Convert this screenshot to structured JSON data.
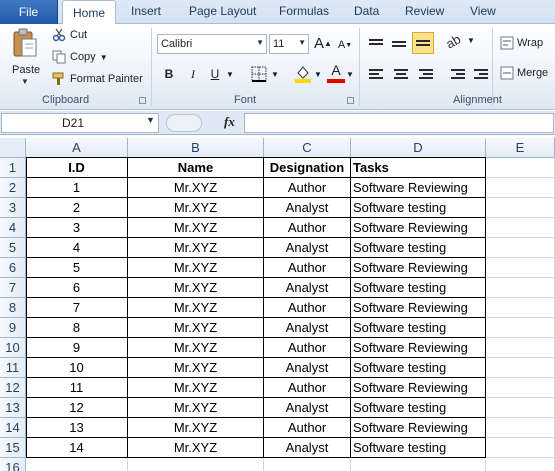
{
  "ribbon": {
    "tabs": [
      {
        "label": "File"
      },
      {
        "label": "Home"
      },
      {
        "label": "Insert"
      },
      {
        "label": "Page Layout"
      },
      {
        "label": "Formulas"
      },
      {
        "label": "Data"
      },
      {
        "label": "Review"
      },
      {
        "label": "View"
      }
    ],
    "clipboard": {
      "paste_label": "Paste",
      "cut_label": "Cut",
      "copy_label": "Copy",
      "format_painter_label": "Format Painter",
      "group_label": "Clipboard"
    },
    "font": {
      "font_name": "Calibri",
      "font_size": "11",
      "bold_label": "B",
      "italic_label": "I",
      "underline_label": "U",
      "grow_label": "A",
      "shrink_label": "A",
      "font_color_label": "A",
      "group_label": "Font"
    },
    "alignment": {
      "wrap_label": "Wrap",
      "merge_label": "Merge",
      "group_label": "Alignment"
    }
  },
  "formula_bar": {
    "name_box": "D21",
    "fx_label": "fx",
    "formula": ""
  },
  "sheet": {
    "columns": [
      "A",
      "B",
      "C",
      "D",
      "E"
    ],
    "rows": [
      {
        "num": "1",
        "a": "I.D",
        "b": "Name",
        "c": "Designation",
        "d": "Tasks"
      },
      {
        "num": "2",
        "a": "1",
        "b": "Mr.XYZ",
        "c": "Author",
        "d": "Software Reviewing"
      },
      {
        "num": "3",
        "a": "2",
        "b": "Mr.XYZ",
        "c": "Analyst",
        "d": "Software testing"
      },
      {
        "num": "4",
        "a": "3",
        "b": "Mr.XYZ",
        "c": "Author",
        "d": "Software Reviewing"
      },
      {
        "num": "5",
        "a": "4",
        "b": "Mr.XYZ",
        "c": "Analyst",
        "d": "Software testing"
      },
      {
        "num": "6",
        "a": "5",
        "b": "Mr.XYZ",
        "c": "Author",
        "d": "Software Reviewing"
      },
      {
        "num": "7",
        "a": "6",
        "b": "Mr.XYZ",
        "c": "Analyst",
        "d": "Software testing"
      },
      {
        "num": "8",
        "a": "7",
        "b": "Mr.XYZ",
        "c": "Author",
        "d": "Software Reviewing"
      },
      {
        "num": "9",
        "a": "8",
        "b": "Mr.XYZ",
        "c": "Analyst",
        "d": "Software testing"
      },
      {
        "num": "10",
        "a": "9",
        "b": "Mr.XYZ",
        "c": "Author",
        "d": "Software Reviewing"
      },
      {
        "num": "11",
        "a": "10",
        "b": "Mr.XYZ",
        "c": "Analyst",
        "d": "Software testing"
      },
      {
        "num": "12",
        "a": "11",
        "b": "Mr.XYZ",
        "c": "Author",
        "d": "Software Reviewing"
      },
      {
        "num": "13",
        "a": "12",
        "b": "Mr.XYZ",
        "c": "Analyst",
        "d": "Software testing"
      },
      {
        "num": "14",
        "a": "13",
        "b": "Mr.XYZ",
        "c": "Author",
        "d": "Software Reviewing"
      },
      {
        "num": "15",
        "a": "14",
        "b": "Mr.XYZ",
        "c": "Analyst",
        "d": "Software testing"
      },
      {
        "num": "16",
        "a": "",
        "b": "",
        "c": "",
        "d": ""
      }
    ]
  },
  "colors": {
    "file_tab": "#2a64b0",
    "ribbon_bg": "#dde7f3",
    "highlight_fill": "#ffd700",
    "font_color": "#e00000"
  },
  "icons": [
    "paste-icon",
    "cut-icon",
    "copy-icon",
    "format-painter-icon",
    "borders-icon",
    "fill-color-icon",
    "font-color-icon",
    "fx-icon"
  ]
}
